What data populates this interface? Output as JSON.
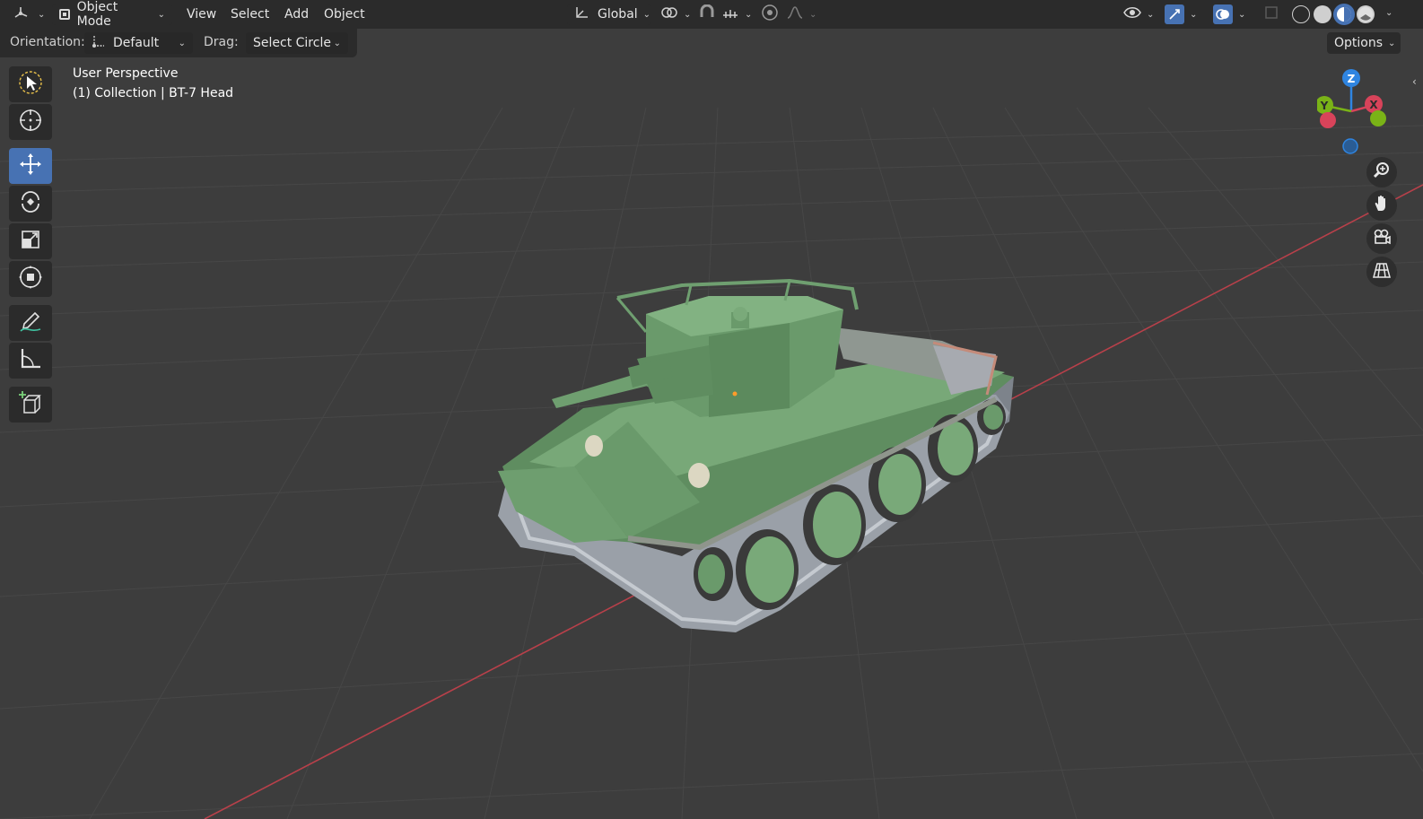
{
  "header": {
    "editor_type_icon": "3d-viewport-icon",
    "mode": "Object Mode",
    "menus": [
      "View",
      "Select",
      "Add",
      "Object"
    ],
    "transform_orientation": "Global"
  },
  "tool_settings": {
    "orientation_label": "Orientation:",
    "orientation_value": "Default",
    "drag_label": "Drag:",
    "drag_value": "Select Circle",
    "options_label": "Options"
  },
  "viewport": {
    "perspective": "User Perspective",
    "collection": "(1) Collection | BT-7 Head"
  },
  "gizmo": {
    "x": "X",
    "y": "Y",
    "z": "Z"
  },
  "tools": [
    "select-box",
    "cursor",
    "move",
    "rotate",
    "scale",
    "transform",
    "annotate",
    "measure",
    "add-cube"
  ],
  "colors": {
    "active_tool": "#4772b3",
    "axis_x": "#d8435a",
    "axis_y": "#7ab317",
    "axis_z": "#2f85e1",
    "tank_green": "#6a9c6b",
    "track_gray": "#9aa0a8"
  }
}
